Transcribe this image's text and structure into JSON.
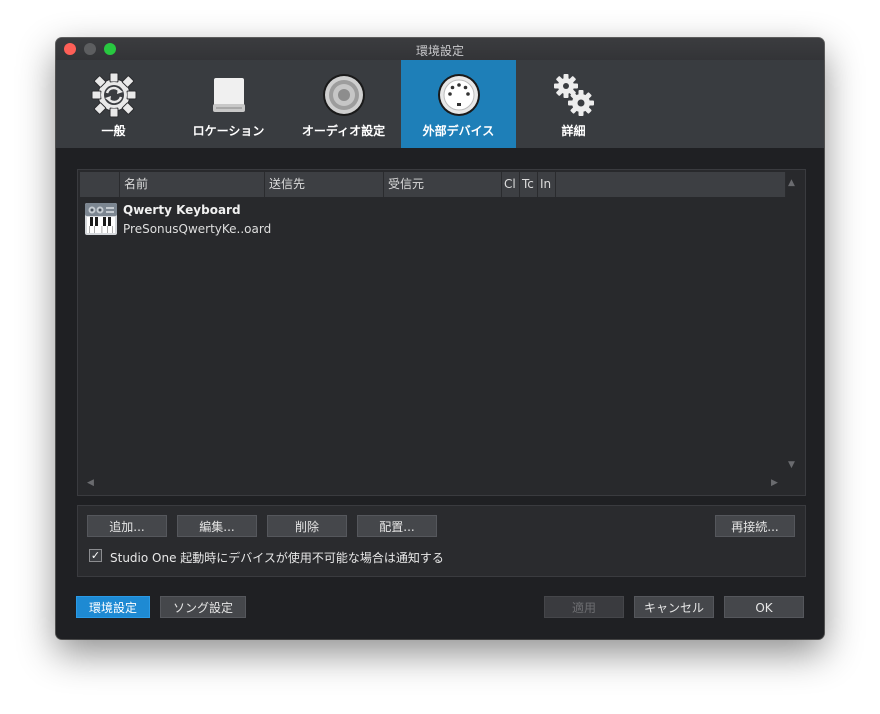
{
  "window": {
    "title": "環境設定"
  },
  "toolbar": {
    "items": [
      {
        "label": "一般",
        "icon": "gear-refresh-icon",
        "active": false
      },
      {
        "label": "ロケーション",
        "icon": "hard-drive-icon",
        "active": false
      },
      {
        "label": "オーディオ設定",
        "icon": "speaker-icon",
        "active": false
      },
      {
        "label": "外部デバイス",
        "icon": "midi-connector-icon",
        "active": true
      },
      {
        "label": "詳細",
        "icon": "gears-icon",
        "active": false
      }
    ]
  },
  "table": {
    "columns": [
      "",
      "名前",
      "送信先",
      "受信元",
      "Cl",
      "Tc",
      "In",
      ""
    ],
    "rows": [
      {
        "name": "Qwerty Keyboard",
        "model": "PreSonusQwertyKe..oard",
        "icon": "keyboard-icon"
      }
    ]
  },
  "buttons": {
    "add": "追加...",
    "edit": "編集...",
    "delete": "削除",
    "arrange": "配置...",
    "reconnect": "再接続..."
  },
  "notify_option": {
    "checked": true,
    "label": "Studio One 起動時にデバイスが使用不可能な場合は通知する"
  },
  "footer": {
    "preferences": "環境設定",
    "song_settings": "ソング設定",
    "apply": "適用",
    "cancel": "キャンセル",
    "ok": "OK"
  },
  "colors": {
    "accent": "#1e7fb8",
    "primary_button": "#1e8ad3",
    "background": "#1f2023",
    "toolbar": "#393c40"
  }
}
